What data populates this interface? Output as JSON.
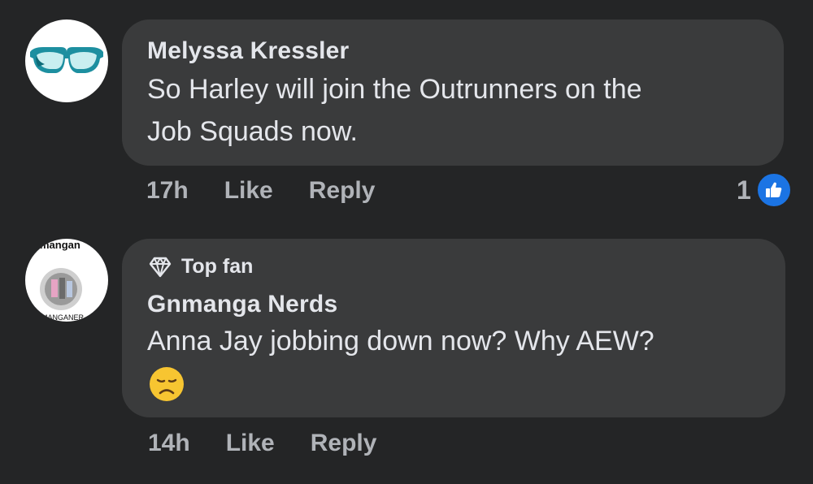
{
  "comments": [
    {
      "author": "Melyssa Kressler",
      "text_lines": [
        "So Harley will join the Outrunners on the",
        "Job Squads now."
      ],
      "time": "17h",
      "like_label": "Like",
      "reply_label": "Reply",
      "reaction_count": "1",
      "avatar_icon": "eyeglasses-icon"
    },
    {
      "badge": "Top fan",
      "author": "Gnmanga Nerds",
      "text_lines": [
        "Anna Jay jobbing down now? Why AEW?"
      ],
      "emoji": "disappointed-face",
      "time": "14h",
      "like_label": "Like",
      "reply_label": "Reply",
      "avatar_icon": "page-logo-icon",
      "avatar_texts": [
        "mangan",
        "MANGANER"
      ]
    }
  ],
  "colors": {
    "background": "#242526",
    "bubble": "#3a3b3c",
    "text": "#e4e6eb",
    "secondary": "#b0b3b8",
    "like_blue": "#1b74e4"
  }
}
